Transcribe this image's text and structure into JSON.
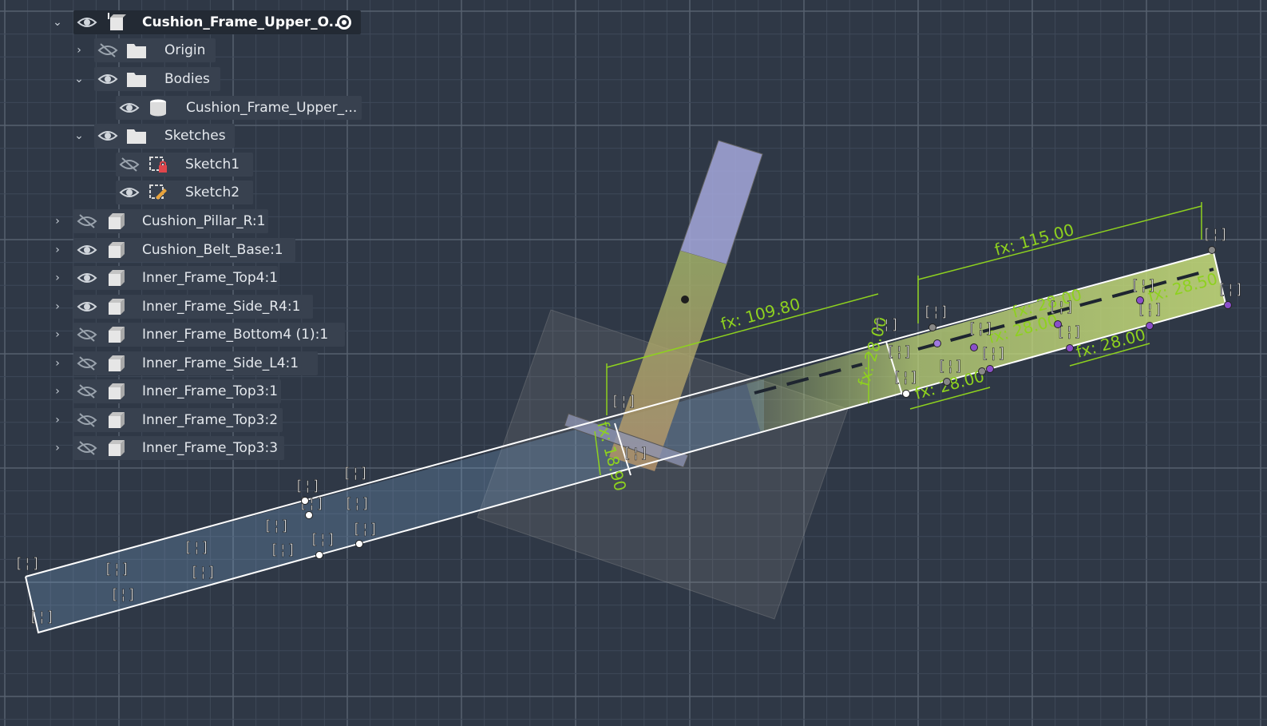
{
  "browser": {
    "component": {
      "label": "Cushion_Frame_Upper_O..."
    },
    "origin": {
      "label": "Origin"
    },
    "bodies": {
      "label": "Bodies"
    },
    "body_item": {
      "label": "Cushion_Frame_Upper_..."
    },
    "sketches": {
      "label": "Sketches"
    },
    "sketch1": {
      "label": "Sketch1"
    },
    "sketch2": {
      "label": "Sketch2"
    },
    "components": [
      {
        "label": "Cushion_Pillar_R:1",
        "visible": false
      },
      {
        "label": "Cushion_Belt_Base:1",
        "visible": true
      },
      {
        "label": "Inner_Frame_Top4:1",
        "visible": true
      },
      {
        "label": "Inner_Frame_Side_R4:1",
        "visible": true
      },
      {
        "label": "Inner_Frame_Bottom4 (1):1",
        "visible": false
      },
      {
        "label": "Inner_Frame_Side_L4:1",
        "visible": false
      },
      {
        "label": "Inner_Frame_Top3:1",
        "visible": false
      },
      {
        "label": "Inner_Frame_Top3:2",
        "visible": false
      },
      {
        "label": "Inner_Frame_Top3:3",
        "visible": false
      }
    ]
  },
  "dimensions": {
    "d1": "fx: 115.00",
    "d2": "fx: 109.80",
    "d3": "fx: 18.90",
    "d4": "fx: 28.50",
    "d5": "fx: 28.00",
    "d6": "fx: 28.00",
    "d7": "fx: 28.00",
    "d8": "fx: 28.00",
    "d9": "fx: 28.00"
  },
  "colors": {
    "background": "#2f3846",
    "grid": "#4a5566",
    "dimension": "#8ed11f",
    "sketch_line": "#ffffff",
    "constraint_point": "#8a4fc9"
  }
}
